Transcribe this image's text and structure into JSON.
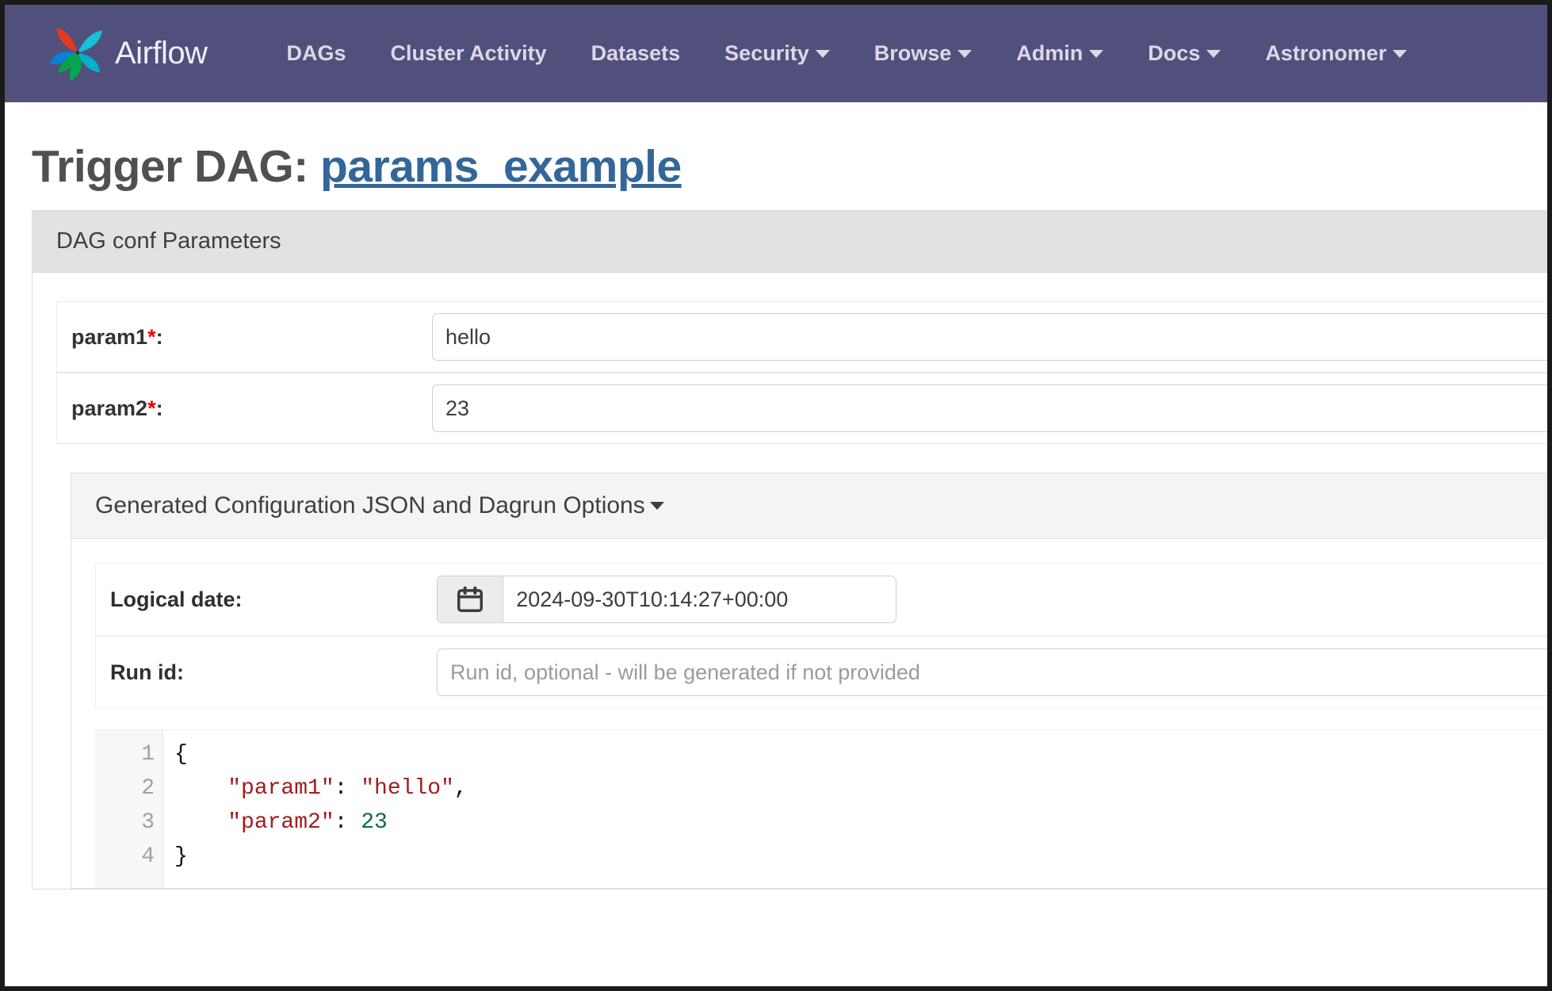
{
  "navbar": {
    "brand_label": "Airflow",
    "brand_logo_icon": "airflow-pinwheel-logo",
    "background_color": "#51507d",
    "items": [
      {
        "label": "DAGs",
        "has_caret": false
      },
      {
        "label": "Cluster Activity",
        "has_caret": false
      },
      {
        "label": "Datasets",
        "has_caret": false
      },
      {
        "label": "Security",
        "has_caret": true
      },
      {
        "label": "Browse",
        "has_caret": true
      },
      {
        "label": "Admin",
        "has_caret": true
      },
      {
        "label": "Docs",
        "has_caret": true
      },
      {
        "label": "Astronomer",
        "has_caret": true
      }
    ]
  },
  "page": {
    "title_prefix": "Trigger DAG:",
    "dag_name": "params_example",
    "dag_name_color": "#336699"
  },
  "conf_panel": {
    "header": "DAG conf Parameters",
    "params": [
      {
        "label": "param1",
        "required_marker": "*",
        "colon": ":",
        "value": "hello",
        "input_name": "param1-input"
      },
      {
        "label": "param2",
        "required_marker": "*",
        "colon": ":",
        "value": "23",
        "input_name": "param2-input"
      }
    ]
  },
  "dagrun_panel": {
    "header": "Generated Configuration JSON and Dagrun Options",
    "logical_date": {
      "label": "Logical date:",
      "value": "2024-09-30T10:14:27+00:00",
      "calendar_icon": "calendar-icon"
    },
    "run_id": {
      "label": "Run id:",
      "value": "",
      "placeholder": "Run id, optional - will be generated if not provided"
    },
    "editor": {
      "line_numbers": [
        "1",
        "2",
        "3",
        "4"
      ],
      "lines": [
        {
          "indent": "",
          "parts": [
            {
              "t": "{",
              "c": "tok-punct"
            }
          ]
        },
        {
          "indent": "    ",
          "parts": [
            {
              "t": "\"param1\"",
              "c": "tok-key"
            },
            {
              "t": ": ",
              "c": "tok-punct"
            },
            {
              "t": "\"hello\"",
              "c": "tok-str"
            },
            {
              "t": ",",
              "c": "tok-punct"
            }
          ]
        },
        {
          "indent": "    ",
          "parts": [
            {
              "t": "\"param2\"",
              "c": "tok-key"
            },
            {
              "t": ": ",
              "c": "tok-punct"
            },
            {
              "t": "23",
              "c": "tok-num"
            }
          ]
        },
        {
          "indent": "",
          "parts": [
            {
              "t": "}",
              "c": "tok-punct"
            }
          ]
        }
      ],
      "key_color": "#a21c1c",
      "number_color": "#0f6b45",
      "gutter_color": "#a0a0a0"
    }
  }
}
